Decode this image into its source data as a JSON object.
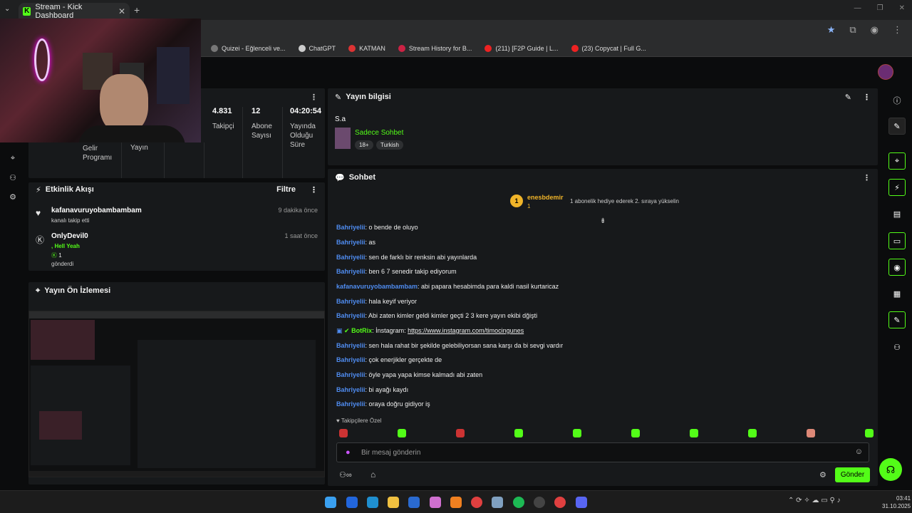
{
  "browser": {
    "tab_title": "Stream - Kick Dashboard",
    "new_tab": "+",
    "tab_close": "✕",
    "bookmarks": [
      "Quizei - Eğlenceli ve...",
      "ChatGPT",
      "KATMAN",
      "Stream History for B...",
      "(211) [F2P Guide | L...",
      "(23) Copycat | Full G..."
    ]
  },
  "stats": {
    "items": [
      {
        "value": "4.831",
        "label": "Takipçi"
      },
      {
        "value": "12",
        "label": "Abone Sayısı"
      },
      {
        "value": "04:20:54",
        "label": "Yayında Olduğu Süre"
      }
    ],
    "lower_labels": [
      "Gelir Programı",
      "Yayın"
    ]
  },
  "activity": {
    "title": "Etkinlik Akışı",
    "filter": "Filtre",
    "items": [
      {
        "name": "kafanavuruyobambambam",
        "sub": "kanalı takip etti",
        "time": "9 dakika önce"
      },
      {
        "name": "OnlyDevil0",
        "extra": ", Hell Yeah",
        "count": "1",
        "sub": "gönderdi",
        "time": "1 saat önce"
      }
    ]
  },
  "preview": {
    "title": "Yayın Ön İzlemesi"
  },
  "stream_info": {
    "title": "Yayın bilgisi",
    "stream_title": "S.a",
    "category": "Sadece Sohbet",
    "tags": [
      "18+",
      "Turkish"
    ]
  },
  "chat": {
    "title": "Sohbet",
    "top_gifter": {
      "name": "enesbdemir",
      "rank": "1",
      "count": "1"
    },
    "gift_hint": "1 abonelik hediye ederek 2. sıraya yükselin",
    "messages": [
      {
        "user": "Bahriyelii",
        "text": ": o bende de oluyo"
      },
      {
        "user": "Bahriyelii",
        "text": ": as"
      },
      {
        "user": "Bahriyelii",
        "text": ": sen de farklı bir renksin abi yayınlarda"
      },
      {
        "user": "Bahriyelii",
        "text": ": ben 6 7 senedir takip ediyorum"
      },
      {
        "user": "kafanavuruyobambambam",
        "text": ": abi papara hesabimda para kaldi nasil kurtaricaz"
      },
      {
        "user": "Bahriyelii",
        "text": ": hala keyif veriyor"
      },
      {
        "user": "Bahriyelii",
        "text": ": Abi zaten kimler geldi kimler geçti 2 3 kere yayın ekibi dğişti"
      },
      {
        "user": "BotRix",
        "text": ": İnstagram: ",
        "link": "https://www.instagram.com/timocingunes"
      },
      {
        "user": "Bahriyelii",
        "text": ": sen hala rahat bir şekilde gelebiliyorsan sana karşı da bi sevgi vardır"
      },
      {
        "user": "Bahriyelii",
        "text": ": çok enerjikler gerçekte de"
      },
      {
        "user": "Bahriyelii",
        "text": ": öyle yapa yapa kimse kalmadı abi zaten"
      },
      {
        "user": "Bahriyelii",
        "text": ": bi ayağı kaydı"
      },
      {
        "user": "Bahriyelii",
        "text": ": oraya doğru gidiyor iş"
      }
    ],
    "followers_only": "Takipçilere Özel",
    "input_placeholder": "Bir mesaj gönderin",
    "send_label": "Gönder"
  },
  "taskbar": {
    "time": "03:41",
    "date": "31.10.2025"
  },
  "colors": {
    "accent": "#53fc18",
    "username": "#4f8cf0",
    "panel": "#17191b"
  }
}
